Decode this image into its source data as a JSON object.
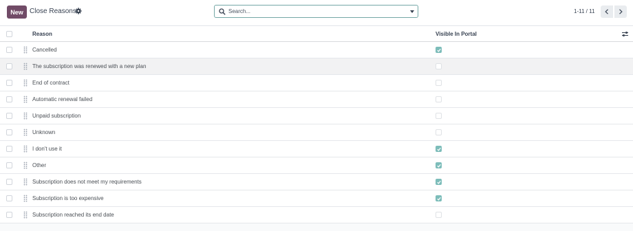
{
  "control_panel": {
    "new_label": "New",
    "title": "Close Reasons",
    "search_placeholder": "Search...",
    "pager_text": "1-11 / 11"
  },
  "list": {
    "columns": {
      "reason": "Reason",
      "visible": "Visible In Portal"
    },
    "rows": [
      {
        "reason": "Cancelled",
        "visible": true
      },
      {
        "reason": "The subscription was renewed with a new plan",
        "visible": false
      },
      {
        "reason": "End of contract",
        "visible": false
      },
      {
        "reason": "Automatic renewal failed",
        "visible": false
      },
      {
        "reason": "Unpaid subscription",
        "visible": false
      },
      {
        "reason": "Unknown",
        "visible": false
      },
      {
        "reason": "I don't use it",
        "visible": true
      },
      {
        "reason": "Other",
        "visible": true
      },
      {
        "reason": "Subscription does not meet my requirements",
        "visible": true
      },
      {
        "reason": "Subscription is too expensive",
        "visible": true
      },
      {
        "reason": "Subscription reached its end date",
        "visible": false
      }
    ]
  },
  "colors": {
    "brand": "#714b67",
    "checked": "#7dbdba",
    "search_border": "#74a7a6"
  }
}
